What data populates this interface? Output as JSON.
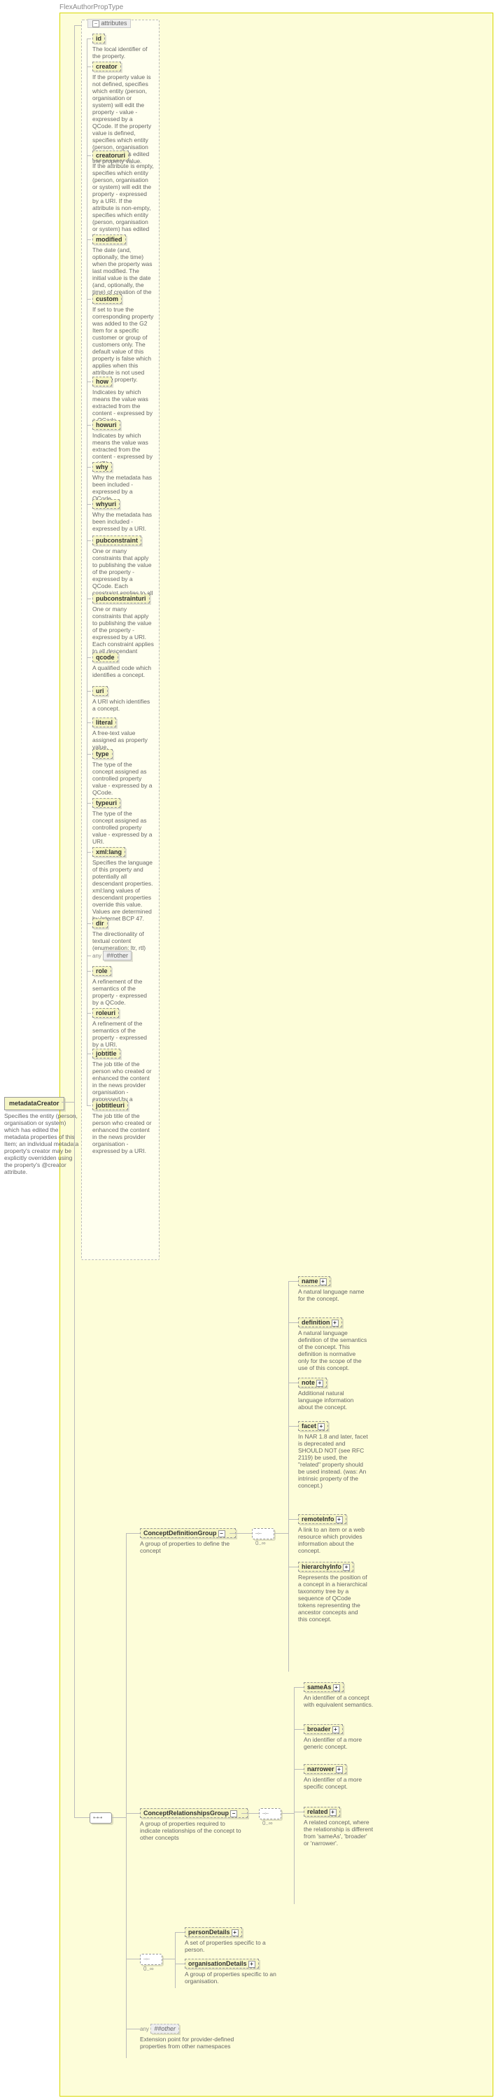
{
  "page_title": "FlexAuthorPropType",
  "root": {
    "label": "metadataCreator",
    "desc": "Specifies the entity (person, organisation or system) which has edited the metadata properties of this Item; an individual metadata property's creator may be explicitly overridden using the property's @creator attribute."
  },
  "attributes_label": "attributes",
  "attrs": {
    "id": {
      "label": "id",
      "desc": "The local identifier of the property."
    },
    "creator": {
      "label": "creator",
      "desc": "If the property value is not defined, specifies which entity (person, organisation or system) will edit the property - value - expressed by a QCode. If the property value is defined, specifies which entity (person, organisation or system) has edited the property value."
    },
    "creatoruri": {
      "label": "creatoruri",
      "desc": "If the attribute is empty, specifies which entity (person, organisation or system) will edit the property - expressed by a URI. If the attribute is non-empty, specifies which entity (person, organisation or system) has edited the property."
    },
    "modified": {
      "label": "modified",
      "desc": "The date (and, optionally, the time) when the property was last modified. The initial value is the date (and, optionally, the time) of creation of the property."
    },
    "custom": {
      "label": "custom",
      "desc": "If set to true the corresponding property was added to the G2 Item for a specific customer or group of customers only. The default value of this property is false which applies when this attribute is not used with the property."
    },
    "how": {
      "label": "how",
      "desc": "Indicates by which means the value was extracted from the content - expressed by a QCode."
    },
    "howuri": {
      "label": "howuri",
      "desc": "Indicates by which means the value was extracted from the content - expressed by a URI."
    },
    "why": {
      "label": "why",
      "desc": "Why the metadata has been included - expressed by a QCode."
    },
    "whyuri": {
      "label": "whyuri",
      "desc": "Why the metadata has been included - expressed by a URI."
    },
    "pubconstraint": {
      "label": "pubconstraint",
      "desc": "One or many constraints that apply to publishing the value of the property - expressed by a QCode. Each constraint applies to all descendant elements."
    },
    "pubconstrainturi": {
      "label": "pubconstrainturi",
      "desc": "One or many constraints that apply to publishing the value of the property - expressed by a URI. Each constraint applies to all descendant elements."
    },
    "qcode": {
      "label": "qcode",
      "desc": "A qualified code which identifies a concept."
    },
    "uri": {
      "label": "uri",
      "desc": "A URI which identifies a concept."
    },
    "literal": {
      "label": "literal",
      "desc": "A free-text value assigned as property value."
    },
    "type": {
      "label": "type",
      "desc": "The type of the concept assigned as controlled property value - expressed by a QCode."
    },
    "typeuri": {
      "label": "typeuri",
      "desc": "The type of the concept assigned as controlled property value - expressed by a URI."
    },
    "xmllang": {
      "label": "xml:lang",
      "desc": "Specifies the language of this property and potentially all descendant properties. xml:lang values of descendant properties override this value. Values are determined by Internet BCP 47."
    },
    "dir": {
      "label": "dir",
      "desc": "The directionality of textual content (enumeration: ltr, rtl)"
    },
    "anyOther1": {
      "label": "##other",
      "prefix": "any",
      "desc": ""
    },
    "role": {
      "label": "role",
      "desc": "A refinement of the semantics of the property - expressed by a QCode."
    },
    "roleuri": {
      "label": "roleuri",
      "desc": "A refinement of the semantics of the property - expressed by a URI."
    },
    "jobtitle": {
      "label": "jobtitle",
      "desc": "The job title of the person who created or enhanced the content in the news provider organisation - expressed by a QCode."
    },
    "jobtitleuri": {
      "label": "jobtitleuri",
      "desc": "The job title of the person who created or enhanced the content in the news provider organisation - expressed by a URI."
    }
  },
  "groups": {
    "conceptDefinition": {
      "label": "ConceptDefinitionGroup",
      "desc": "A group of properties to define the concept",
      "mult": "0..∞"
    },
    "conceptRelations": {
      "label": "ConceptRelationshipsGroup",
      "desc": "A group of properties required to indicate relationships of the concept to other concepts",
      "mult": "0..∞"
    }
  },
  "defChildren": {
    "name": {
      "label": "name",
      "desc": "A natural language name for the concept."
    },
    "definition": {
      "label": "definition",
      "desc": "A natural language definition of the semantics of the concept. This definition is normative only for the scope of the use of this concept."
    },
    "note": {
      "label": "note",
      "desc": "Additional natural language information about the concept."
    },
    "facet": {
      "label": "facet",
      "desc": "In NAR 1.8 and later, facet is deprecated and SHOULD NOT (see RFC 2119) be used, the \"related\" property should be used instead. (was: An intrinsic property of the concept.)"
    },
    "remoteInfo": {
      "label": "remoteInfo",
      "desc": "A link to an item or a web resource which provides information about the concept."
    },
    "hierarchyInfo": {
      "label": "hierarchyInfo",
      "desc": "Represents the position of a concept in a hierarchical taxonomy tree by a sequence of QCode tokens representing the ancestor concepts and this concept."
    }
  },
  "relChildren": {
    "sameAs": {
      "label": "sameAs",
      "desc": "An identifier of a concept with equivalent semantics."
    },
    "broader": {
      "label": "broader",
      "desc": "An identifier of a more generic concept."
    },
    "narrower": {
      "label": "narrower",
      "desc": "An identifier of a more specific concept."
    },
    "related": {
      "label": "related",
      "desc": "A related concept, where the relationship is different from 'sameAs', 'broader' or 'narrower'."
    }
  },
  "details": {
    "person": {
      "label": "personDetails",
      "desc": "A set of properties specific to a person."
    },
    "org": {
      "label": "organisationDetails",
      "desc": "A group of properties specific to an organisation."
    },
    "mult": "0..∞"
  },
  "extension": {
    "prefix": "any",
    "label": "##other",
    "desc": "Extension point for provider-defined properties from other namespaces"
  }
}
